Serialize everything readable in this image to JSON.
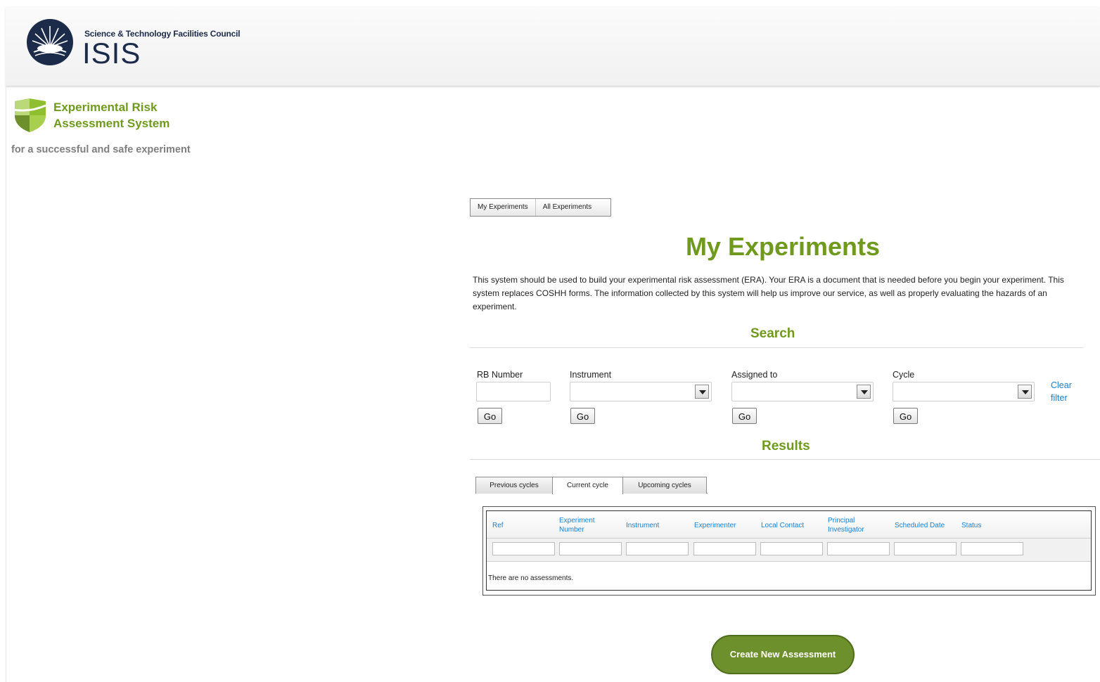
{
  "header": {
    "org": "Science & Technology Facilities Council",
    "brand": "ISIS"
  },
  "era": {
    "title_line1": "Experimental Risk",
    "title_line2": "Assessment System",
    "tagline": "for a successful and safe experiment"
  },
  "switcher": {
    "my": "My Experiments",
    "all": "All Experiments"
  },
  "page": {
    "title": "My Experiments",
    "intro": "This system should be used to build your experimental risk assessment (ERA). Your ERA is a document that is needed before you begin your experiment. This system replaces COSHH forms. The information collected by this system will help us improve our service, as well as properly evaluating the hazards of an experiment."
  },
  "search": {
    "heading": "Search",
    "rb_label": "RB Number",
    "rb_value": "",
    "instrument_label": "Instrument",
    "instrument_value": "",
    "assigned_label": "Assigned to",
    "assigned_value": "",
    "cycle_label": "Cycle",
    "cycle_value": "",
    "go_label": "Go",
    "clear_filter": "Clear filter"
  },
  "results": {
    "heading": "Results",
    "tabs": [
      "Previous cycles",
      "Current cycle",
      "Upcoming cycles"
    ],
    "active_tab": "Current cycle",
    "columns": [
      "Ref",
      "Experiment Number",
      "Instrument",
      "Experimenter",
      "Local Contact",
      "Principal Investigator",
      "Scheduled Date",
      "Status"
    ],
    "empty_message": "There are no assessments."
  },
  "actions": {
    "create": "Create New Assessment"
  },
  "colors": {
    "green": "#6f9a1e",
    "navy": "#1c2b4a",
    "link": "#1a7fd0",
    "button_green": "#6d8f2c"
  }
}
